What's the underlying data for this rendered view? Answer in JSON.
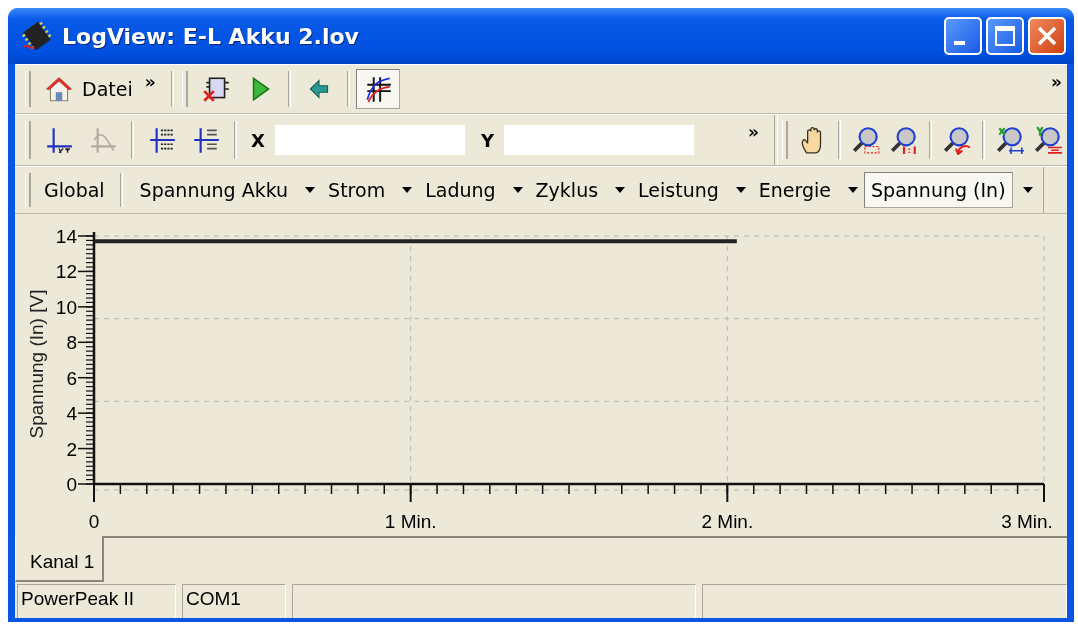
{
  "window": {
    "title": "LogView: E-L Akku 2.lov"
  },
  "toolbar_1": {
    "menu_label": "Datei",
    "menu_overflow": "»",
    "buttons": [
      {
        "kind": "disconnect",
        "pressed": false
      },
      {
        "kind": "play",
        "pressed": false
      },
      {
        "kind": "back",
        "pressed": false
      },
      {
        "kind": "cursor",
        "pressed": true
      }
    ],
    "overflow": "»"
  },
  "toolbar_2": {
    "buttons": [
      {
        "kind": "crosshair",
        "disabled": false
      },
      {
        "kind": "marker",
        "disabled": true
      },
      {
        "kind": "values",
        "disabled": false
      },
      {
        "kind": "delta",
        "disabled": false
      }
    ],
    "x_label": "X",
    "y_label": "Y",
    "overflow": "»",
    "tools": [
      {
        "kind": "hand"
      },
      {
        "kind": "zoombox"
      },
      {
        "kind": "zoomactual"
      },
      {
        "kind": "zoomundo"
      },
      {
        "kind": "zoomx"
      },
      {
        "kind": "zoomy"
      }
    ]
  },
  "channel_bar": {
    "items": [
      {
        "label": "Global",
        "kind": "button",
        "selected": false
      },
      {
        "label": "Spannung Akku",
        "kind": "dropdown",
        "selected": false
      },
      {
        "label": "Strom",
        "kind": "dropdown",
        "selected": false
      },
      {
        "label": "Ladung",
        "kind": "dropdown",
        "selected": false
      },
      {
        "label": "Zyklus",
        "kind": "dropdown",
        "selected": false
      },
      {
        "label": "Leistung",
        "kind": "dropdown",
        "selected": false
      },
      {
        "label": "Energie",
        "kind": "dropdown",
        "selected": false
      },
      {
        "label": "Spannung (In)",
        "kind": "dropdown",
        "selected": true
      }
    ]
  },
  "chart": {
    "chart_data": {
      "type": "line",
      "ylabel": "Spannung (In) [V]",
      "x": [
        0,
        2.03
      ],
      "series": [
        {
          "color": "#222222",
          "values": [
            13.7,
            13.7
          ]
        }
      ],
      "xlim": [
        0,
        3
      ],
      "ylim": [
        0,
        14
      ],
      "xticks": [
        {
          "value": 0,
          "label": "0"
        },
        {
          "value": 1,
          "label": "1 Min."
        },
        {
          "value": 2,
          "label": "2 Min."
        },
        {
          "value": 3,
          "label": "3 Min."
        }
      ],
      "yticks": [
        0,
        2,
        4,
        6,
        8,
        10,
        12,
        14
      ]
    }
  },
  "tabs": [
    {
      "label": "Kanal 1",
      "selected": true
    }
  ],
  "status_bar": [
    "PowerPeak II",
    "COM1"
  ]
}
